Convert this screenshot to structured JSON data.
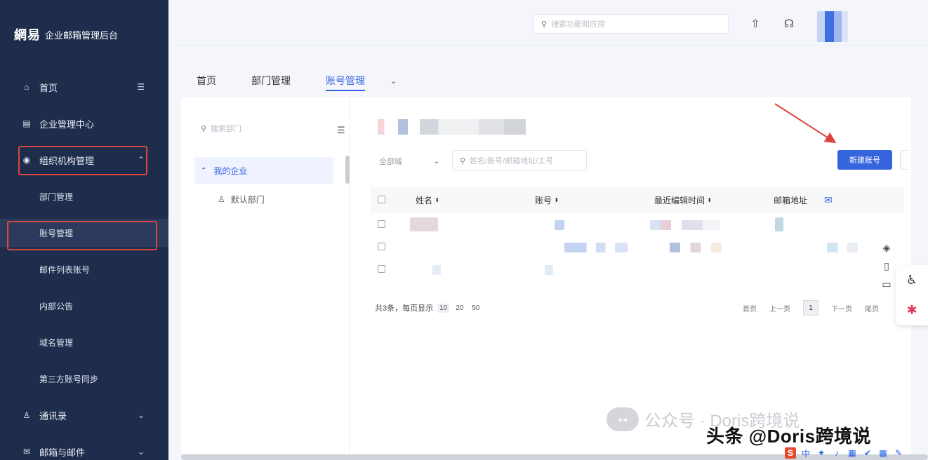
{
  "sidebar": {
    "logo": "網易",
    "title": "企业邮箱管理后台",
    "items": [
      {
        "label": "首页",
        "icon": "home-icon",
        "tail": "☰"
      },
      {
        "label": "企业管理中心",
        "icon": "grid-icon",
        "tail": ""
      },
      {
        "label": "组织机构管理",
        "icon": "org-icon",
        "tail": "⌃"
      }
    ],
    "sub_items": [
      {
        "label": "部门管理"
      },
      {
        "label": "账号管理"
      },
      {
        "label": "邮件列表账号"
      },
      {
        "label": "内部公告"
      },
      {
        "label": "域名管理"
      },
      {
        "label": "第三方账号同步"
      }
    ],
    "bottom_items": [
      {
        "label": "通讯录",
        "icon": "contacts-icon",
        "tail": "⌄"
      },
      {
        "label": "邮箱与邮件",
        "icon": "mail-icon",
        "tail": "⌄"
      }
    ]
  },
  "header": {
    "search_placeholder": "搜索功能和应用"
  },
  "tabs": [
    {
      "label": "首页"
    },
    {
      "label": "部门管理"
    },
    {
      "label": "账号管理",
      "active": true
    }
  ],
  "dept": {
    "search_placeholder": "搜索部门",
    "root": "我的企业",
    "child": "默认部门"
  },
  "toolbar": {
    "filter_label": "全部域",
    "search_placeholder": "姓名/账号/邮箱地址/工号",
    "new_button": "新建账号"
  },
  "table": {
    "columns": [
      "姓名",
      "账号",
      "最近编辑时间",
      "邮箱地址"
    ]
  },
  "pager": {
    "summary": "共3条，每页显示",
    "sizes": [
      "10",
      "20",
      "50"
    ],
    "first": "首页",
    "prev": "上一页",
    "current": "1",
    "next": "下一页",
    "last": "尾页"
  },
  "watermark": {
    "line1": "公众号 · Doris跨境说",
    "line2": "头条 @Doris跨境说"
  },
  "colors": {
    "sidebar_bg": "#1f2d4d",
    "accent": "#3565dc",
    "highlight_red": "#d9473c"
  }
}
